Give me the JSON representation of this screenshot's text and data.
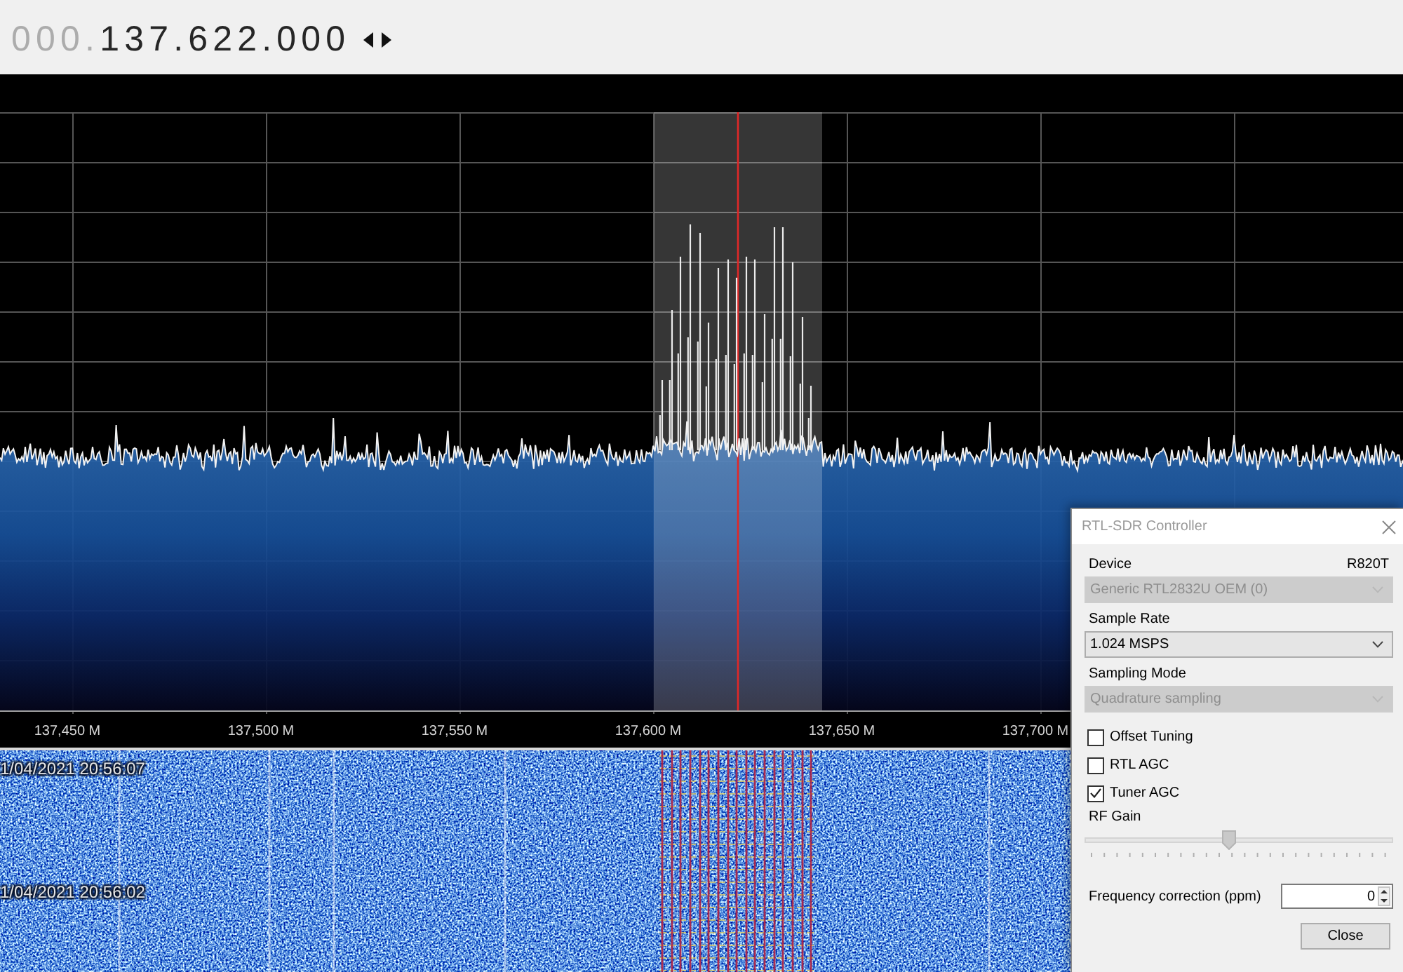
{
  "frequency_display": {
    "leading_digits": "000.",
    "frequency": "137.622.000"
  },
  "spectrum": {
    "axis_labels": [
      "137,450 M",
      "137,500 M",
      "137,550 M",
      "137,600 M",
      "137,650 M",
      "137,700 M"
    ]
  },
  "waterfall": {
    "timestamps": [
      "1/04/2021 20:56:07",
      "1/04/2021 20:56:02"
    ]
  },
  "dialog": {
    "title": "RTL-SDR Controller",
    "dropdowns": [
      {
        "label": "Device",
        "tag": "R820T",
        "value": "Generic RTL2832U OEM (0)",
        "disabled": true
      },
      {
        "label": "Sample Rate",
        "value": "1.024 MSPS",
        "disabled": false
      },
      {
        "label": "Sampling Mode",
        "value": "Quadrature sampling",
        "disabled": true
      }
    ],
    "checkboxes": [
      {
        "label": "Offset Tuning",
        "checked": false
      },
      {
        "label": "RTL AGC",
        "checked": false
      },
      {
        "label": "Tuner AGC",
        "checked": true
      }
    ],
    "rf_gain": {
      "label": "RF Gain",
      "level": 0.46,
      "disabled": true
    },
    "frequency_correction": {
      "label": "Frequency correction (ppm)",
      "value": "0"
    },
    "buttons": [
      "Close"
    ]
  }
}
